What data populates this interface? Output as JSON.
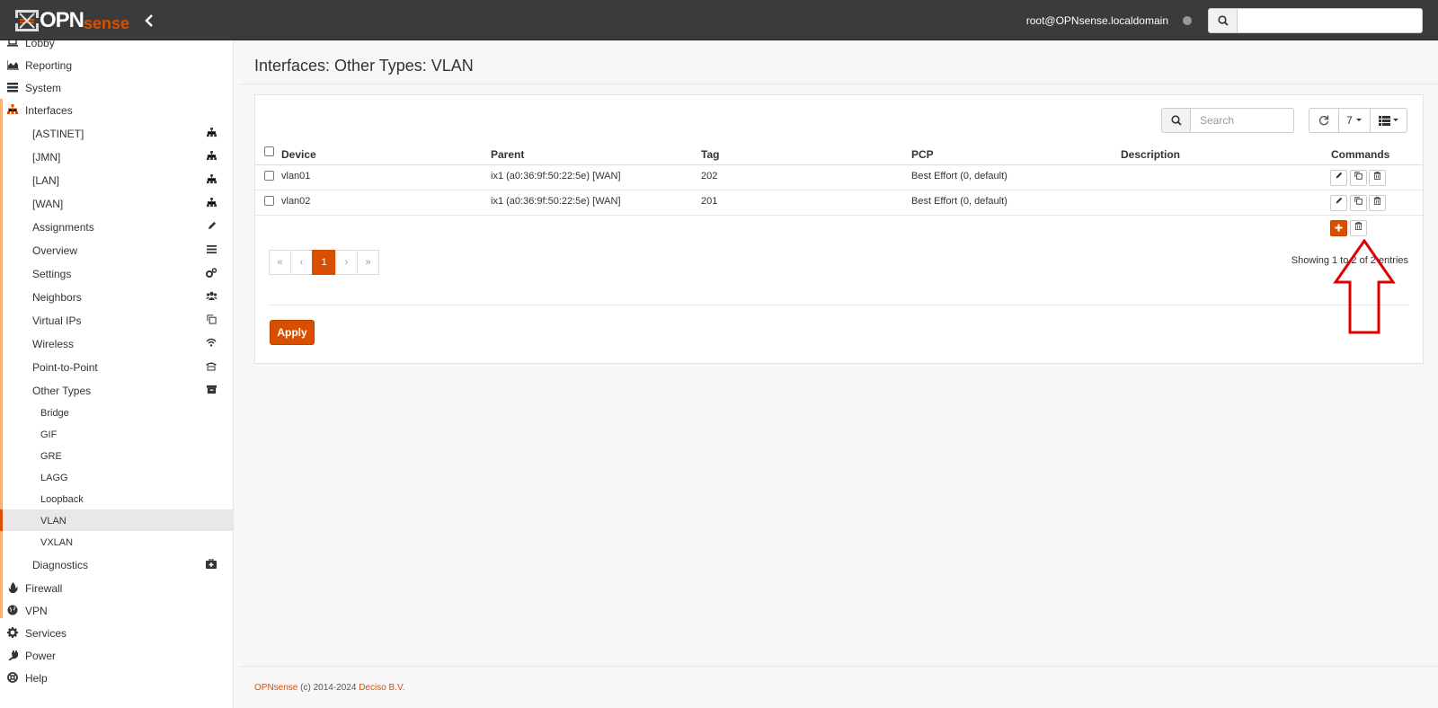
{
  "header": {
    "logo_primary": "OPN",
    "logo_secondary": "sense",
    "user": "root@OPNsense.localdomain",
    "search_placeholder": ""
  },
  "sidebar": {
    "top_items": [
      {
        "label": "Lobby",
        "icon": "laptop-icon"
      },
      {
        "label": "Reporting",
        "icon": "area-chart-icon"
      },
      {
        "label": "System",
        "icon": "server-icon"
      },
      {
        "label": "Interfaces",
        "icon": "sitemap-icon"
      }
    ],
    "interfaces_children": [
      {
        "label": "[ASTINET]",
        "icon": "sitemap-icon"
      },
      {
        "label": "[JMN]",
        "icon": "sitemap-icon"
      },
      {
        "label": "[LAN]",
        "icon": "sitemap-icon"
      },
      {
        "label": "[WAN]",
        "icon": "sitemap-icon"
      },
      {
        "label": "Assignments",
        "icon": "pencil-icon"
      },
      {
        "label": "Overview",
        "icon": "list-icon"
      },
      {
        "label": "Settings",
        "icon": "cogs-icon"
      },
      {
        "label": "Neighbors",
        "icon": "users-icon"
      },
      {
        "label": "Virtual IPs",
        "icon": "clone-icon"
      },
      {
        "label": "Wireless",
        "icon": "wifi-icon"
      },
      {
        "label": "Point-to-Point",
        "icon": "tty-icon"
      },
      {
        "label": "Other Types",
        "icon": "archive-icon"
      }
    ],
    "other_types_children": [
      "Bridge",
      "GIF",
      "GRE",
      "LAGG",
      "Loopback",
      "VLAN",
      "VXLAN"
    ],
    "active_item": "VLAN",
    "after_items": [
      {
        "label": "Diagnostics",
        "icon": "medkit-icon"
      }
    ],
    "bottom_items": [
      {
        "label": "Firewall",
        "icon": "fire-icon"
      },
      {
        "label": "VPN",
        "icon": "globe-icon"
      },
      {
        "label": "Services",
        "icon": "gear-icon"
      },
      {
        "label": "Power",
        "icon": "plug-icon"
      },
      {
        "label": "Help",
        "icon": "lifebuoy-icon"
      }
    ]
  },
  "page": {
    "title": "Interfaces: Other Types: VLAN"
  },
  "grid": {
    "search_placeholder": "Search",
    "row_count": "7",
    "columns": [
      "Device",
      "Parent",
      "Tag",
      "PCP",
      "Description",
      "Commands"
    ],
    "rows": [
      {
        "device": "vlan01",
        "parent": "ix1 (a0:36:9f:50:22:5e) [WAN]",
        "tag": "202",
        "pcp": "Best Effort (0, default)",
        "description": ""
      },
      {
        "device": "vlan02",
        "parent": "ix1 (a0:36:9f:50:22:5e) [WAN]",
        "tag": "201",
        "pcp": "Best Effort (0, default)",
        "description": ""
      }
    ],
    "pagination": [
      "«",
      "‹",
      "1",
      "›",
      "»"
    ],
    "current_page": "1",
    "showing": "Showing 1 to 2 of 2 entries",
    "apply_label": "Apply"
  },
  "footer": {
    "brand": "OPNsense",
    "copyright": " (c) 2014-2024 ",
    "company": "Deciso B.V."
  },
  "colors": {
    "accent": "#d94f00",
    "topbar": "#3b3b3b",
    "annotation_arrow": "#e00000"
  }
}
